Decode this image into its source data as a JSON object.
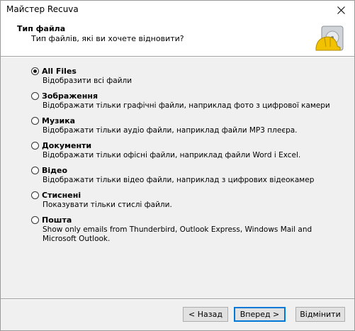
{
  "window": {
    "title": "Майстер Recuva"
  },
  "header": {
    "title": "Тип файла",
    "subtitle": "Тип файлів, які ви хочете відновити?"
  },
  "options": [
    {
      "label": "All Files",
      "description": "Відобразити всі файли",
      "checked": true
    },
    {
      "label": "Зображення",
      "description": "Відображати тільки графічні файли, наприклад фото з цифрової камери",
      "checked": false
    },
    {
      "label": "Музика",
      "description": "Відображати тільки аудіо файли, наприклад файли MP3 плеєра.",
      "checked": false
    },
    {
      "label": "Документи",
      "description": "Відображати тільки офісні файли, наприклад файли Word і Excel.",
      "checked": false
    },
    {
      "label": "Відео",
      "description": "Відображати тільки відео файли, наприклад з цифрових відеокамер",
      "checked": false
    },
    {
      "label": "Стиснені",
      "description": "Показувати тільки стислі файли.",
      "checked": false
    },
    {
      "label": "Пошта",
      "description": "Show only emails from Thunderbird, Outlook Express, Windows Mail and Microsoft Outlook.",
      "checked": false
    }
  ],
  "buttons": {
    "back": "< Назад",
    "next": "Вперед >",
    "cancel": "Відмінити"
  },
  "icons": {
    "close": "close-icon",
    "logo": "recuva-hardhat-logo"
  }
}
